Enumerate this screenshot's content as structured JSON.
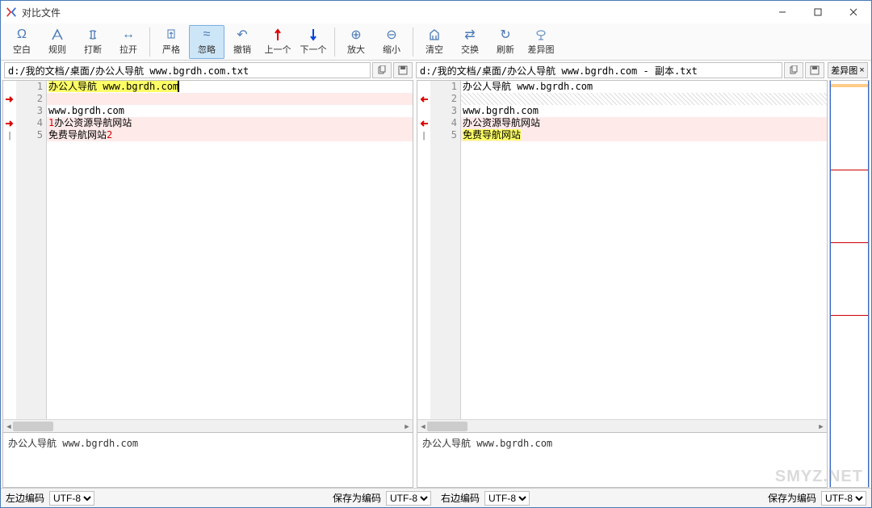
{
  "window": {
    "title": "对比文件"
  },
  "toolbar": {
    "items": [
      {
        "id": "whitespace",
        "label": "空白",
        "icon": "Ω"
      },
      {
        "id": "rule",
        "label": "规则",
        "icon": "rule"
      },
      {
        "id": "break",
        "label": "打断",
        "icon": "break"
      },
      {
        "id": "split",
        "label": "拉开",
        "icon": "↔"
      },
      {
        "id": "sep1",
        "sep": true
      },
      {
        "id": "strict",
        "label": "严格",
        "icon": "↥"
      },
      {
        "id": "ignore",
        "label": "忽略",
        "icon": "≈",
        "active": true
      },
      {
        "id": "undo",
        "label": "撤销",
        "icon": "↶"
      },
      {
        "id": "prev",
        "label": "上一个",
        "icon": "↑",
        "color": "#d00"
      },
      {
        "id": "next",
        "label": "下一个",
        "icon": "↓",
        "color": "#04d"
      },
      {
        "id": "sep2",
        "sep": true
      },
      {
        "id": "zoomin",
        "label": "放大",
        "icon": "⊕"
      },
      {
        "id": "zoomout",
        "label": "缩小",
        "icon": "⊖"
      },
      {
        "id": "sep3",
        "sep": true
      },
      {
        "id": "clear",
        "label": "清空",
        "icon": "clear"
      },
      {
        "id": "swap",
        "label": "交换",
        "icon": "⇄"
      },
      {
        "id": "refresh",
        "label": "刷新",
        "icon": "↻"
      },
      {
        "id": "diffview",
        "label": "差异图",
        "icon": "◎"
      }
    ]
  },
  "paths": {
    "left": "d:/我的文档/桌面/办公人导航 www.bgrdh.com.txt",
    "right": "d:/我的文档/桌面/办公人导航 www.bgrdh.com - 副本.txt"
  },
  "diff_tab": "差异图",
  "left": {
    "lines": [
      {
        "n": 1,
        "text": "办公人导航 www.bgrdh.com",
        "hl": "yellow",
        "caret": true
      },
      {
        "n": 2,
        "text": "",
        "bg": "pink",
        "marker": "→"
      },
      {
        "n": 3,
        "text": "www.bgrdh.com"
      },
      {
        "n": 4,
        "prefix": "1",
        "text": "办公资源导航网站",
        "bg": "pink",
        "marker": "→"
      },
      {
        "n": 5,
        "text": "免费导航网站",
        "suffix": "2",
        "bg": "pink",
        "marker": "|"
      }
    ],
    "detail": "办公人导航 www.bgrdh.com"
  },
  "right": {
    "lines": [
      {
        "n": 1,
        "text": "办公人导航 www.bgrdh.com"
      },
      {
        "n": 2,
        "text": "",
        "bg": "hatch",
        "marker": "←"
      },
      {
        "n": 3,
        "text": "www.bgrdh.com"
      },
      {
        "n": 4,
        "text": "办公资源导航网站",
        "bg": "pink",
        "marker": "←"
      },
      {
        "n": 5,
        "text": "免费导航网站",
        "hl": "yellow",
        "bg": "pink",
        "marker": "|"
      }
    ],
    "detail": "办公人导航 www.bgrdh.com"
  },
  "status": {
    "left_enc_label": "左边编码",
    "left_enc": "UTF-8",
    "save_enc_label": "保存为编码",
    "save_enc": "UTF-8",
    "right_enc_label": "右边编码",
    "right_enc": "UTF-8"
  },
  "watermark": "SMYZ.NET"
}
